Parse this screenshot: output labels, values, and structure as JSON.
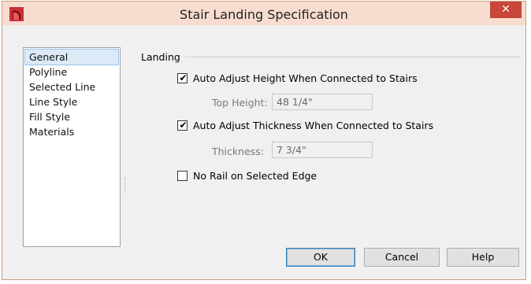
{
  "window": {
    "title": "Stair Landing Specification",
    "close_glyph": "✕",
    "app_icon": "app-logo-icon"
  },
  "nav": {
    "items": [
      {
        "label": "General",
        "selected": true
      },
      {
        "label": "Polyline",
        "selected": false
      },
      {
        "label": "Selected Line",
        "selected": false
      },
      {
        "label": "Line Style",
        "selected": false
      },
      {
        "label": "Fill Style",
        "selected": false
      },
      {
        "label": "Materials",
        "selected": false
      }
    ]
  },
  "landing": {
    "group_label": "Landing",
    "auto_height": {
      "label": "Auto Adjust Height When Connected to Stairs",
      "checked": true
    },
    "top_height": {
      "label": "Top Height:",
      "value": "48 1/4\""
    },
    "auto_thickness": {
      "label": "Auto Adjust Thickness When Connected to Stairs",
      "checked": true
    },
    "thickness": {
      "label": "Thickness:",
      "value": "7 3/4\""
    },
    "no_rail": {
      "label": "No Rail on Selected Edge",
      "checked": false
    }
  },
  "buttons": {
    "ok": "OK",
    "cancel": "Cancel",
    "help": "Help"
  },
  "colors": {
    "titlebar": "#f7dccf",
    "close": "#c8463a",
    "selection": "#dceaf8"
  }
}
